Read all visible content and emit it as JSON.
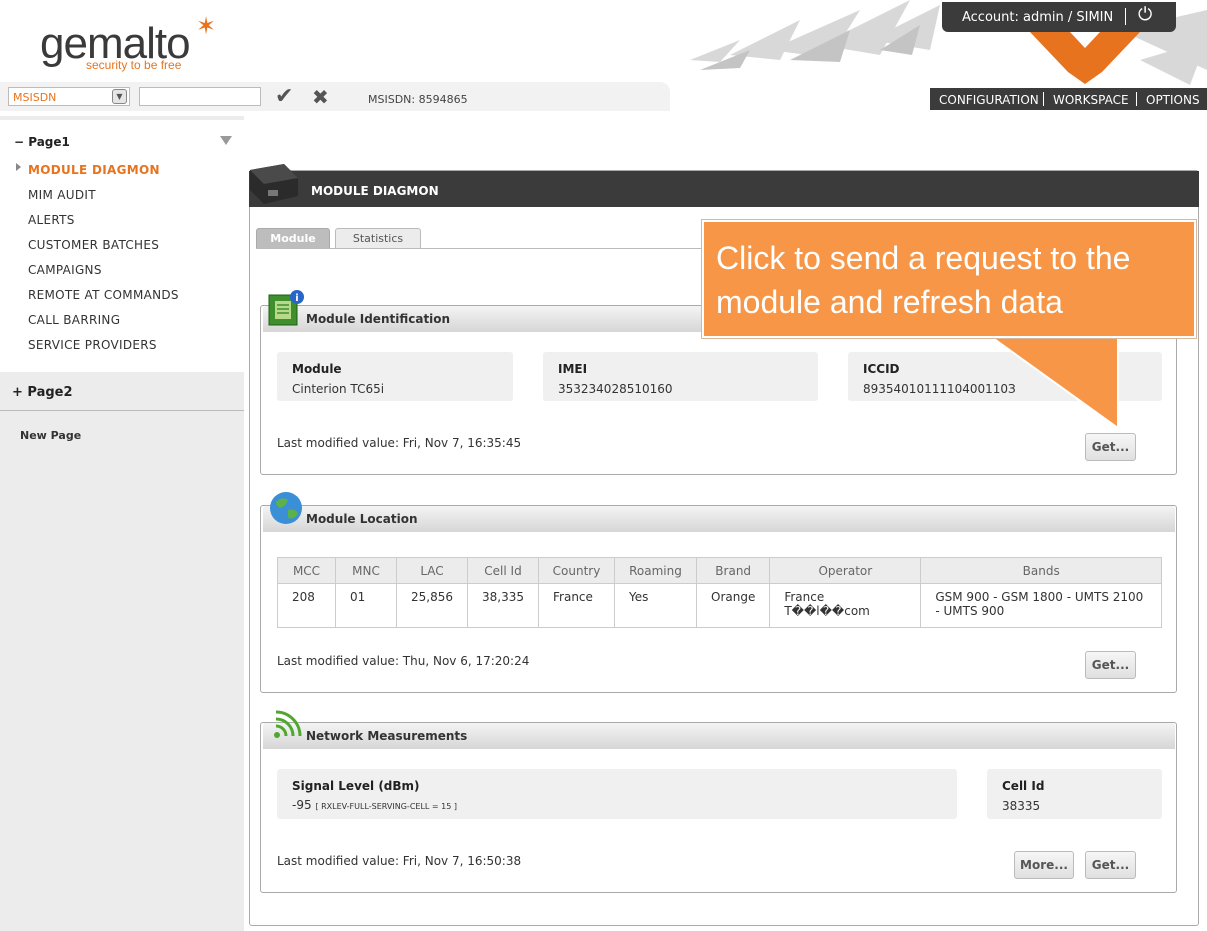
{
  "brand": {
    "name": "gemalto",
    "tagline": "security to be free"
  },
  "account": {
    "label": "Account: admin / SIMIN",
    "power_icon": "power-icon"
  },
  "nav": {
    "items": [
      "CONFIGURATION",
      "WORKSPACE",
      "OPTIONS"
    ]
  },
  "search": {
    "selector_value": "MSISDN",
    "input_value": "",
    "msisdn_display": "MSISDN: 8594865"
  },
  "sidebar": {
    "page1_label": "Page1",
    "items": [
      "MODULE DIAGMON",
      "MIM AUDIT",
      "ALERTS",
      "CUSTOMER BATCHES",
      "CAMPAIGNS",
      "REMOTE AT COMMANDS",
      "CALL BARRING",
      "SERVICE PROVIDERS"
    ],
    "page2_label": "Page2",
    "new_page_label": "New Page"
  },
  "panel": {
    "title": "MODULE DIAGMON",
    "tabs": [
      "Module",
      "Statistics"
    ],
    "identification": {
      "title": "Module Identification",
      "fields": [
        {
          "label": "Module",
          "value": "Cinterion TC65i"
        },
        {
          "label": "IMEI",
          "value": "353234028510160"
        },
        {
          "label": "ICCID",
          "value": "8935401011110400110З"
        }
      ],
      "last_modified": "Last modified value:  Fri, Nov 7, 16:35:45",
      "get_label": "Get..."
    },
    "location": {
      "title": "Module Location",
      "columns": [
        "MCC",
        "MNC",
        "LAC",
        "Cell Id",
        "Country",
        "Roaming",
        "Brand",
        "Operator",
        "Bands"
      ],
      "row": [
        "208",
        "01",
        "25,856",
        "38,335",
        "France",
        "Yes",
        "Orange",
        "France T��l��com",
        "GSM 900 - GSM 1800 - UMTS 2100 - UMTS 900"
      ],
      "last_modified": "Last modified value:  Thu, Nov 6, 17:20:24",
      "get_label": "Get..."
    },
    "network": {
      "title": "Network Measurements",
      "signal_label": "Signal Level (dBm)",
      "signal_value": "-95",
      "signal_detail": "[ RXLEV-FULL-SERVING-CELL = 15 ]",
      "cell_label": "Cell Id",
      "cell_value": "38335",
      "last_modified": "Last modified value:  Fri, Nov 7, 16:50:38",
      "more_label": "More...",
      "get_label": "Get..."
    }
  },
  "callout": {
    "text": "Click to send a request to the module and refresh data"
  }
}
